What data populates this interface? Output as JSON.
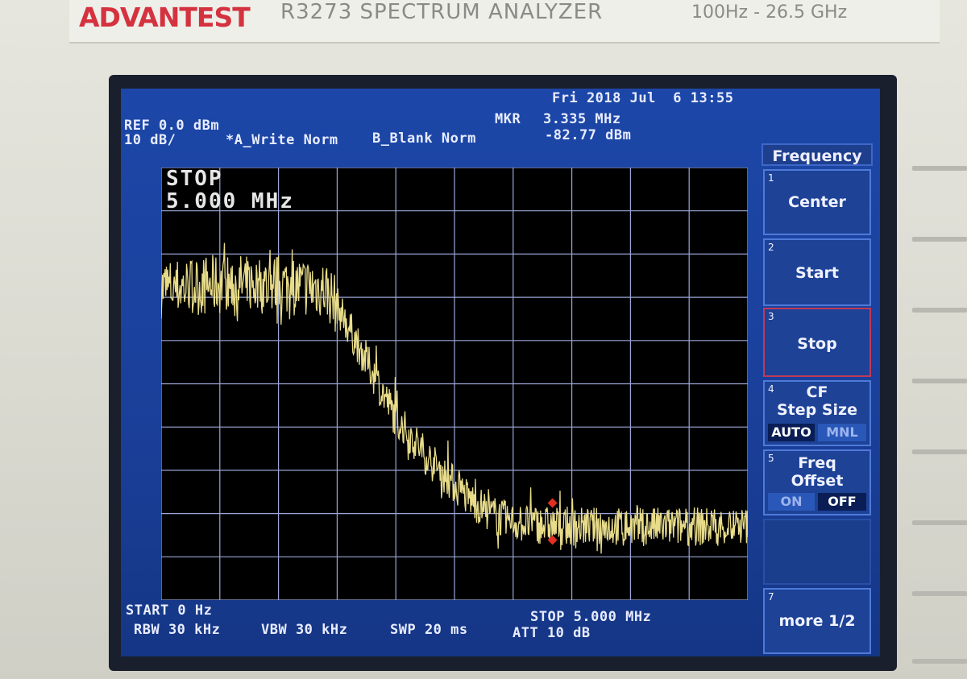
{
  "nameplate": {
    "brand": "ADVANTEST",
    "model": "R3273 SPECTRUM ANALYZER",
    "range": "100Hz - 26.5 GHz"
  },
  "status": {
    "datetime": "Fri 2018 Jul  6 13:55",
    "ref_level": "REF 0.0 dBm",
    "scale": "10 dB/",
    "trace_a": "*A_Write Norm",
    "trace_b": "B_Blank Norm",
    "marker_label": "MKR",
    "marker_freq": "3.335 MHz",
    "marker_amp": "-82.77 dBm"
  },
  "active_entry": {
    "line1": "STOP",
    "line2": "5.000 MHz"
  },
  "footer": {
    "start": "START 0 Hz",
    "rbw": "RBW 30 kHz",
    "vbw": "VBW 30 kHz",
    "swp": "SWP 20 ms",
    "stop": "STOP 5.000 MHz",
    "att": "ATT 10 dB"
  },
  "softkeys": {
    "title": "Frequency",
    "center": {
      "num": "1",
      "label": "Center"
    },
    "start": {
      "num": "2",
      "label": "Start"
    },
    "stop": {
      "num": "3",
      "label": "Stop"
    },
    "cf_step": {
      "num": "4",
      "label1": "CF",
      "label2": "Step Size",
      "opt_a": "AUTO",
      "opt_b": "MNL"
    },
    "freq_offset": {
      "num": "5",
      "label1": "Freq",
      "label2": "Offset",
      "opt_a": "ON",
      "opt_b": "OFF"
    },
    "more": {
      "num": "7",
      "label": "more 1/2"
    }
  },
  "colors": {
    "trace": "#e8dc8a",
    "marker": "#e03020",
    "display_bg": "#1c47a8",
    "grid": "#9aa6d6"
  },
  "chart_data": {
    "type": "line",
    "x_unit": "MHz",
    "y_unit": "dBm",
    "xlim": [
      0,
      5
    ],
    "ylim": [
      -100,
      0
    ],
    "x": [
      0,
      0.5,
      1.0,
      1.4,
      1.5,
      1.7,
      2.0,
      2.3,
      2.6,
      2.8,
      3.0,
      3.3,
      3.6,
      4.0,
      4.5,
      5.0
    ],
    "y": [
      -28,
      -27,
      -27,
      -28,
      -32,
      -42,
      -58,
      -68,
      -76,
      -80,
      -82,
      -82.77,
      -83,
      -83,
      -83,
      -83
    ],
    "marker": {
      "x": 3.335,
      "y": -82.77
    }
  }
}
